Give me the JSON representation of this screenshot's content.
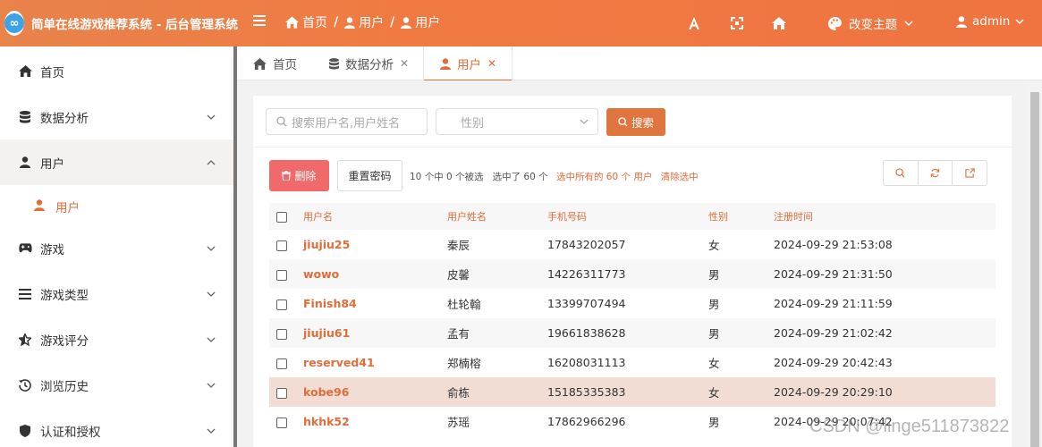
{
  "app": {
    "title": "简单在线游戏推荐系统 - 后台管理系统",
    "logo_text": "∞"
  },
  "header": {
    "breadcrumb": [
      "首页",
      "用户",
      "用户"
    ],
    "theme_label": "改变主题",
    "user_label": "admin",
    "accent_color": "#ef7a43"
  },
  "sidebar": {
    "items": [
      {
        "label": "首页",
        "icon": "home-icon"
      },
      {
        "label": "数据分析",
        "icon": "database-icon"
      },
      {
        "label": "用户",
        "icon": "user-icon"
      },
      {
        "label": "用户",
        "icon": "user-icon"
      },
      {
        "label": "游戏",
        "icon": "gamepad-icon"
      },
      {
        "label": "游戏类型",
        "icon": "list-icon"
      },
      {
        "label": "游戏评分",
        "icon": "star-icon"
      },
      {
        "label": "浏览历史",
        "icon": "history-icon"
      },
      {
        "label": "认证和授权",
        "icon": "shield-icon"
      }
    ]
  },
  "tabs": [
    {
      "label": "首页"
    },
    {
      "label": "数据分析"
    },
    {
      "label": "用户"
    }
  ],
  "search": {
    "keyword_placeholder": "搜索用户名,用户姓名",
    "gender_placeholder": "性别",
    "search_label": "搜索"
  },
  "toolbar": {
    "delete_label": "删除",
    "reset_password_label": "重置密码",
    "selection_text": "10 个中 0 个被选   选中了 60 个",
    "select_all_label": "选中所有的 60 个 用户",
    "clear_label": "清除选中"
  },
  "table": {
    "headers": [
      "用户名",
      "用户姓名",
      "手机号码",
      "性别",
      "注册时间"
    ],
    "rows": [
      [
        "jiujiu25",
        "秦辰",
        "17843202057",
        "女",
        "2024-09-29 21:53:08"
      ],
      [
        "wowo",
        "皮馨",
        "14226311773",
        "男",
        "2024-09-29 21:31:50"
      ],
      [
        "Finish84",
        "杜轮翰",
        "13399707494",
        "男",
        "2024-09-29 21:11:59"
      ],
      [
        "jiujiu61",
        "孟有",
        "19661838628",
        "男",
        "2024-09-29 21:02:42"
      ],
      [
        "reserved41",
        "郑楠榕",
        "16208031113",
        "女",
        "2024-09-29 20:42:43"
      ],
      [
        "kobe96",
        "俞栋",
        "15185335383",
        "女",
        "2024-09-29 20:29:10"
      ],
      [
        "hkhk52",
        "苏瑶",
        "17862966296",
        "男",
        "2024-09-29 20:07:42"
      ]
    ]
  },
  "watermark": "CSDN @linge511873822"
}
